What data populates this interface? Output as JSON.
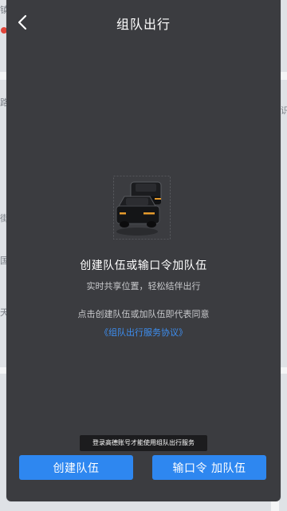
{
  "header": {
    "title": "组队出行"
  },
  "main": {
    "headline": "创建队伍或输口令加队伍",
    "subline": "实时共享位置，轻松结伴出行",
    "agreement_prefix": "点击创建队伍或加队伍即代表同意",
    "agreement_link": "《组队出行服务协议》"
  },
  "toast": "登录高德账号才能使用组队出行服务",
  "buttons": {
    "create_label": "创建队伍",
    "join_label": "输口令 加队伍"
  },
  "map_labels": [
    "镇",
    "路",
    "街",
    "国",
    "天",
    "识"
  ],
  "colors": {
    "panel": "#3b3c40",
    "accent": "#2e87f0",
    "link": "#3d8ef0"
  }
}
